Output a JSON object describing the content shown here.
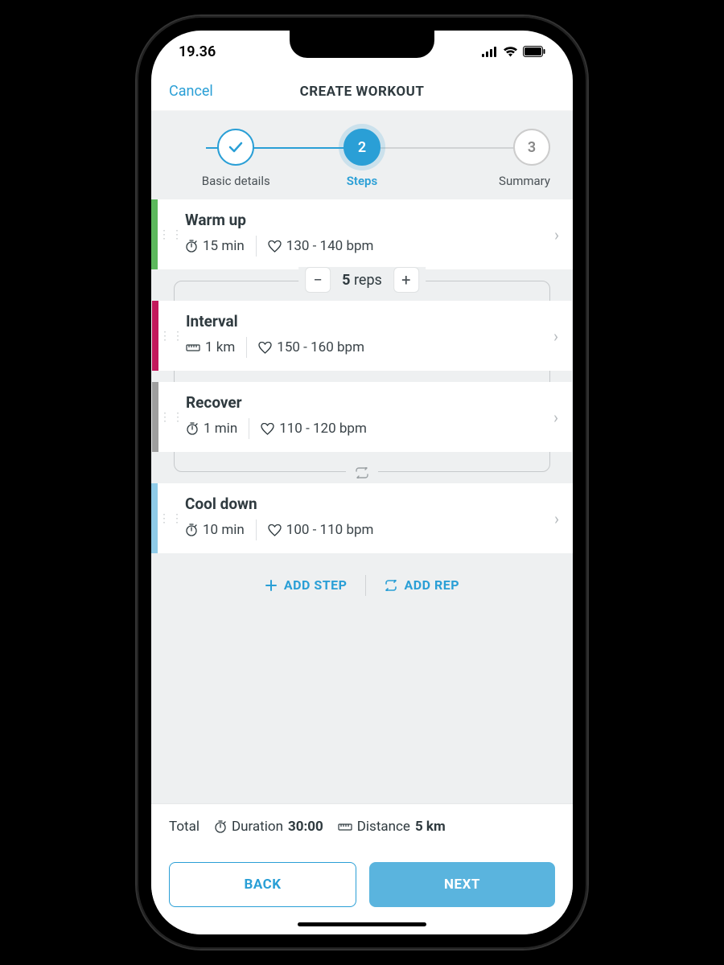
{
  "status": {
    "time": "19.36"
  },
  "nav": {
    "cancel": "Cancel",
    "title": "CREATE WORKOUT"
  },
  "wizard": {
    "step1": {
      "label": "Basic details"
    },
    "step2": {
      "num": "2",
      "label": "Steps"
    },
    "step3": {
      "num": "3",
      "label": "Summary"
    }
  },
  "reps": {
    "count": "5",
    "unit": "reps"
  },
  "steps": {
    "warmup": {
      "title": "Warm up",
      "duration": "15 min",
      "hr": "130 - 140 bpm",
      "color": "#5cb85c"
    },
    "interval": {
      "title": "Interval",
      "distance": "1 km",
      "hr": "150 - 160 bpm",
      "color": "#c2185b"
    },
    "recover": {
      "title": "Recover",
      "duration": "1 min",
      "hr": "110 - 120 bpm",
      "color": "#9e9e9e"
    },
    "cooldown": {
      "title": "Cool down",
      "duration": "10 min",
      "hr": "100 - 110 bpm",
      "color": "#62b5e5"
    }
  },
  "actions": {
    "add_step": "ADD STEP",
    "add_rep": "ADD REP"
  },
  "totals": {
    "label": "Total",
    "duration_label": "Duration",
    "duration_value": "30:00",
    "distance_label": "Distance",
    "distance_value": "5 km"
  },
  "footer": {
    "back": "BACK",
    "next": "NEXT"
  }
}
